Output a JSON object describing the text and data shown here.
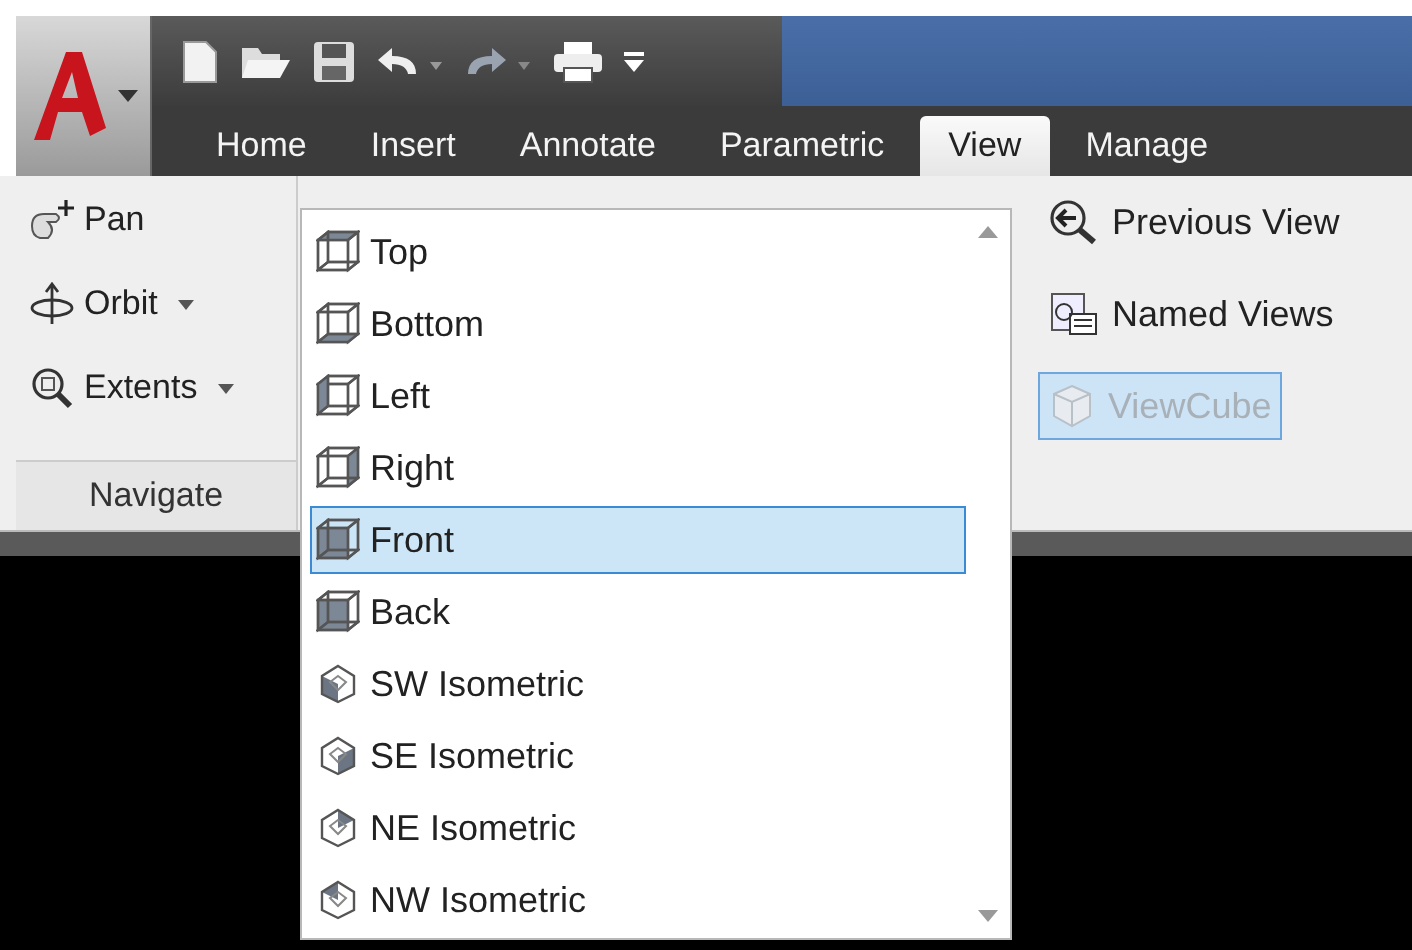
{
  "tabs": [
    {
      "label": "Home",
      "selected": false
    },
    {
      "label": "Insert",
      "selected": false
    },
    {
      "label": "Annotate",
      "selected": false
    },
    {
      "label": "Parametric",
      "selected": false
    },
    {
      "label": "View",
      "selected": true
    },
    {
      "label": "Manage",
      "selected": false
    }
  ],
  "navigate_panel": {
    "title": "Navigate",
    "tools": [
      {
        "kind": "pan",
        "label": "Pan",
        "has_dropdown": false
      },
      {
        "kind": "orbit",
        "label": "Orbit",
        "has_dropdown": true
      },
      {
        "kind": "extents",
        "label": "Extents",
        "has_dropdown": true
      }
    ]
  },
  "view_list": {
    "items": [
      {
        "label": "Top",
        "kind": "orthographic",
        "selected": false
      },
      {
        "label": "Bottom",
        "kind": "orthographic",
        "selected": false
      },
      {
        "label": "Left",
        "kind": "orthographic",
        "selected": false
      },
      {
        "label": "Right",
        "kind": "orthographic",
        "selected": false
      },
      {
        "label": "Front",
        "kind": "orthographic",
        "selected": true
      },
      {
        "label": "Back",
        "kind": "orthographic",
        "selected": false
      },
      {
        "label": "SW Isometric",
        "kind": "isometric",
        "selected": false
      },
      {
        "label": "SE Isometric",
        "kind": "isometric",
        "selected": false
      },
      {
        "label": "NE Isometric",
        "kind": "isometric",
        "selected": false
      },
      {
        "label": "NW Isometric",
        "kind": "isometric",
        "selected": false
      }
    ]
  },
  "views_panel": {
    "tools": [
      {
        "kind": "previous",
        "label": "Previous View",
        "on": false,
        "disabled": false
      },
      {
        "kind": "named",
        "label": "Named Views",
        "on": false,
        "disabled": false
      },
      {
        "kind": "viewcube",
        "label": "ViewCube",
        "on": true,
        "disabled": true
      }
    ]
  }
}
